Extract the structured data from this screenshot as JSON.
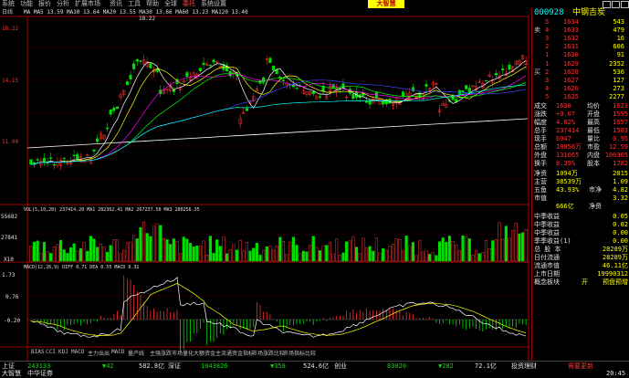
{
  "menu": {
    "items": [
      "系统",
      "功能",
      "报价",
      "分析",
      "扩展市场",
      "资讯",
      "工具",
      "帮助",
      "全球",
      "委托",
      "系统设置"
    ],
    "brand": "大智慧"
  },
  "tabbar": {
    "period": "日线",
    "ma_legend": "MA MA5 13.59 MA10 13.64 MA20 13.55 MA30 13.66 MA60 13.23 MA120 13.40"
  },
  "main_chart": {
    "price_labels": [
      "18.22",
      "14.15",
      "11.00"
    ],
    "high_label": "18.22",
    "low_label": "10.00"
  },
  "vol_panel": {
    "legend": "VOL(5,10,20)  237414.20  MA1 282362.41  MA2 267237.50  MA3 280256.35",
    "labels": [
      "55682",
      "27841",
      "X10"
    ]
  },
  "macd_panel": {
    "legend": "MACD(12,26,9)  DIFF 0.71  DEA 0.55  MACD 0.31",
    "labels": [
      "1.73",
      "0.76",
      "-0.20"
    ]
  },
  "bottom_tabs": [
    "BIAS",
    "CCI",
    "KDJ",
    "MACD",
    "主力出出",
    "MACD",
    "量产线",
    "主强涨跌",
    "市场量化",
    "大额资金",
    "主流通资金指标",
    "市场涨跌比较",
    "市场指标比较"
  ],
  "side": {
    "code": "000928",
    "name": "中钢吉炭",
    "sell_label": "卖",
    "buy_label": "买",
    "sell": [
      {
        "level": "5",
        "price": "1634",
        "vol": "543"
      },
      {
        "level": "4",
        "price": "1633",
        "vol": "479"
      },
      {
        "level": "3",
        "price": "1632",
        "vol": "16"
      },
      {
        "level": "2",
        "price": "1631",
        "vol": "606"
      },
      {
        "level": "1",
        "price": "1630",
        "vol": "91"
      }
    ],
    "buy": [
      {
        "level": "1",
        "price": "1629",
        "vol": "2352"
      },
      {
        "level": "2",
        "price": "1628",
        "vol": "536"
      },
      {
        "level": "3",
        "price": "1627",
        "vol": "127"
      },
      {
        "level": "4",
        "price": "1626",
        "vol": "273"
      },
      {
        "level": "5",
        "price": "1625",
        "vol": "2277"
      }
    ],
    "stats": [
      {
        "l1": "成交",
        "v1": "1630",
        "l2": "均价",
        "v2": "1623"
      },
      {
        "l1": "涨跌",
        "v1": "+0.07",
        "l2": "开盘",
        "v2": "1595"
      },
      {
        "l1": "幅度",
        "v1": "4.62%",
        "l2": "最高",
        "v2": "1657"
      },
      {
        "l1": "总手",
        "v1": "237414",
        "l2": "最低",
        "v2": "1583"
      },
      {
        "l1": "现手",
        "v1": "6947",
        "l2": "量比",
        "v2": "0.95"
      },
      {
        "l1": "总额",
        "v1": "18856万",
        "l2": "市盈",
        "v2": "12.59"
      },
      {
        "l1": "外盘",
        "v1": "131065",
        "l2": "内盘",
        "v2": "106365"
      },
      {
        "l1": "换手",
        "v1": "8.39%",
        "l2": "股本",
        "v2": "1782"
      }
    ],
    "info": [
      {
        "label": "净资",
        "value": "1094万",
        "v": "2015"
      },
      {
        "label": "主营",
        "value": "38539万",
        "v": "1.09"
      },
      {
        "label": "五鱼",
        "value": "43.93%",
        "v2": "市净",
        "v": "4.82"
      },
      {
        "label": "市值",
        "value": "",
        "v2": "",
        "v": "3.32"
      },
      {
        "label": "",
        "value": "666亿",
        "v2": "净资",
        "v": ""
      }
    ],
    "finance": [
      {
        "label": "中季收益",
        "value": "0.05"
      },
      {
        "label": "中季收益",
        "value": "0.02"
      },
      {
        "label": "中季收益",
        "value": "0.00"
      },
      {
        "label": "季季收益(1)",
        "value": "0.00"
      },
      {
        "label": "总 股 本",
        "value": "28289万"
      },
      {
        "label": "日付流通",
        "value": "28289万"
      },
      {
        "label": "流通市值",
        "value": "46.11亿"
      },
      {
        "label": "上市日期",
        "value": "19990312"
      },
      {
        "label": "概念板块",
        "value": "开",
        "v": "预盘预增"
      }
    ]
  },
  "status": {
    "line1": [
      {
        "t": "上证",
        "c": "white"
      },
      {
        "t": "243133",
        "c": "green"
      },
      {
        "t": "▼42",
        "c": "green"
      },
      {
        "t": "582.8亿",
        "c": "white"
      },
      {
        "t": "深证",
        "c": "white"
      },
      {
        "t": "1043826",
        "c": "green"
      },
      {
        "t": "▼358",
        "c": "green"
      },
      {
        "t": "524.6亿",
        "c": "white"
      },
      {
        "t": "创业",
        "c": "white"
      },
      {
        "t": "83020",
        "c": "green"
      },
      {
        "t": "▼282",
        "c": "green"
      },
      {
        "t": "72.1亿",
        "c": "white"
      },
      {
        "t": "投资理财",
        "c": "white"
      },
      {
        "t": "需要更新",
        "c": "red"
      }
    ],
    "line2": [
      {
        "t": "大智慧",
        "c": "white"
      },
      {
        "t": "中华证券",
        "c": "white"
      },
      {
        "t": "20:45",
        "c": "white"
      }
    ]
  },
  "colors": {
    "up": "#ff3030",
    "down": "#00e000",
    "ma5": "#ffffff",
    "ma10": "#ffff00",
    "ma20": "#ff00ff",
    "ma30": "#00ff00",
    "ma60": "#4040ff",
    "ma120": "#00ffff"
  }
}
